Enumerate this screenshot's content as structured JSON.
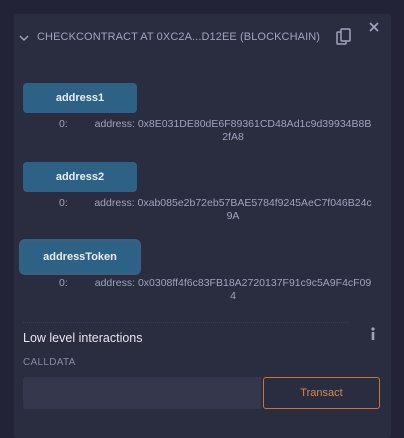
{
  "header": {
    "title": "CHECKCONTRACT AT 0XC2A...D12EE (BLOCKCHAIN)",
    "chevron_icon": "chevron-down-icon",
    "copy_icon": "copy-icon",
    "close_icon": "close-icon"
  },
  "functions": [
    {
      "label": "address1",
      "result_index": "0:",
      "result_value": "address: 0x8E031DE80dE6F89361CD48Ad1c9d39934B8B2fA8"
    },
    {
      "label": "address2",
      "result_index": "0:",
      "result_value": "address: 0xab085e2b72eb57BAE5784f9245AeC7f046B24c9A"
    },
    {
      "label": "addressToken",
      "result_index": "0:",
      "result_value": "address: 0x0308ff4f6c83FB18A2720137F91c9c5A9F4cF094"
    }
  ],
  "low_level": {
    "title": "Low level interactions",
    "info_icon": "info-icon",
    "calldata_label": "CALLDATA",
    "calldata_value": "",
    "transact_label": "Transact"
  },
  "colors": {
    "background": "#222336",
    "card": "#2a2c3f",
    "function_button": "#2e6186",
    "transact_border": "#c97539"
  }
}
